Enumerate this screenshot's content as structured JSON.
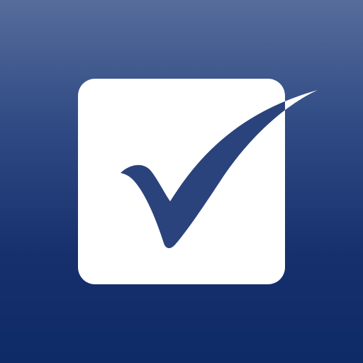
{
  "app_icon": {
    "name": "checkbox-checkmark-logo",
    "colors": {
      "background_top": "#566d9b",
      "background_bottom": "#0e2a67",
      "box_fill": "#ffffff",
      "checkmark_fill": "#2a437c"
    },
    "icons": [
      "checkbox-icon",
      "checkmark-icon"
    ]
  }
}
